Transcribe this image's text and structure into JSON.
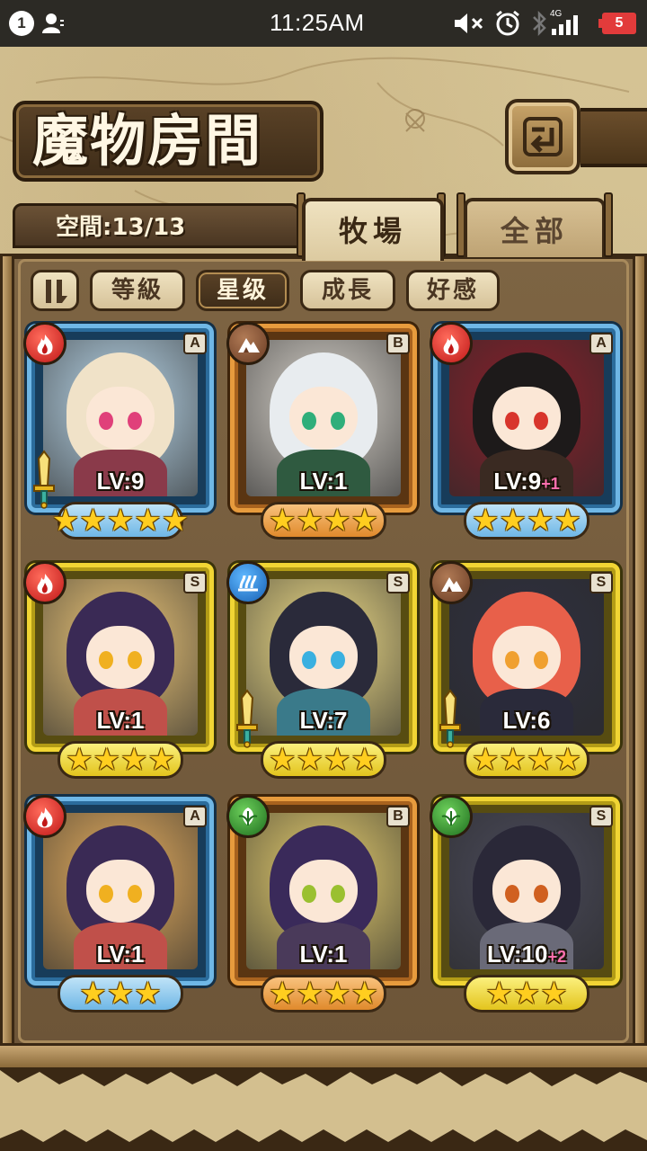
{
  "status_bar": {
    "notification_count": "1",
    "time": "11:25AM",
    "network_label": "4G",
    "battery": "5"
  },
  "header": {
    "title": "魔物房間",
    "back_icon": "back-arrow-icon"
  },
  "space": {
    "label": "空間:13/13"
  },
  "tabs": [
    {
      "label": "牧場",
      "active": true
    },
    {
      "label": "全部",
      "active": false
    }
  ],
  "sort": {
    "toggle_icon": "sort-order-icon",
    "options": [
      {
        "label": "等級",
        "active": false
      },
      {
        "label": "星级",
        "active": true
      },
      {
        "label": "成長",
        "active": false
      },
      {
        "label": "好感",
        "active": false
      }
    ]
  },
  "monsters": [
    {
      "element": "fire",
      "rank": "A",
      "level": "LV:9",
      "plus": "",
      "stars": 5,
      "weapon": true,
      "colors": {
        "hair": "#f0e2c8",
        "body": "#8a3a4a",
        "eye": "#e0407a",
        "bg": "#b9d7ea"
      }
    },
    {
      "element": "earth",
      "rank": "B",
      "level": "LV:1",
      "plus": "",
      "stars": 4,
      "weapon": false,
      "colors": {
        "hair": "#e8ecef",
        "body": "#2f5a40",
        "eye": "#2fae7a",
        "bg": "#d9d4cc"
      }
    },
    {
      "element": "fire",
      "rank": "A",
      "level": "LV:9",
      "plus": "+1",
      "stars": 4,
      "weapon": false,
      "colors": {
        "hair": "#1d1a1a",
        "body": "#3a2a22",
        "eye": "#d8352c",
        "bg": "#8a1f2a"
      }
    },
    {
      "element": "fire",
      "rank": "S",
      "level": "LV:1",
      "plus": "",
      "stars": 4,
      "weapon": false,
      "colors": {
        "hair": "#3a2a55",
        "body": "#c0504a",
        "eye": "#f0b020",
        "bg": "#f0c97a"
      }
    },
    {
      "element": "water",
      "rank": "S",
      "level": "LV:7",
      "plus": "",
      "stars": 4,
      "weapon": true,
      "colors": {
        "hair": "#2a2a3a",
        "body": "#3a7a8a",
        "eye": "#3ab0e0",
        "bg": "#f3e08a"
      }
    },
    {
      "element": "earth",
      "rank": "S",
      "level": "LV:6",
      "plus": "",
      "stars": 4,
      "weapon": true,
      "colors": {
        "hair": "#e8604a",
        "body": "#2a2a3a",
        "eye": "#f0a030",
        "bg": "#2f3040"
      }
    },
    {
      "element": "fire",
      "rank": "A",
      "level": "LV:1",
      "plus": "",
      "stars": 3,
      "weapon": false,
      "colors": {
        "hair": "#3a2a55",
        "body": "#c0504a",
        "eye": "#f0b020",
        "bg": "#e8b060"
      }
    },
    {
      "element": "wood",
      "rank": "B",
      "level": "LV:1",
      "plus": "",
      "stars": 4,
      "weapon": false,
      "colors": {
        "hair": "#3a2a5a",
        "body": "#4a3a5a",
        "eye": "#9ac030",
        "bg": "#e8d070"
      }
    },
    {
      "element": "wood",
      "rank": "S",
      "level": "LV:10",
      "plus": "+2",
      "stars": 3,
      "weapon": false,
      "colors": {
        "hair": "#2a2838",
        "body": "#6a6a78",
        "eye": "#d06020",
        "bg": "#4a4a5a"
      }
    }
  ]
}
